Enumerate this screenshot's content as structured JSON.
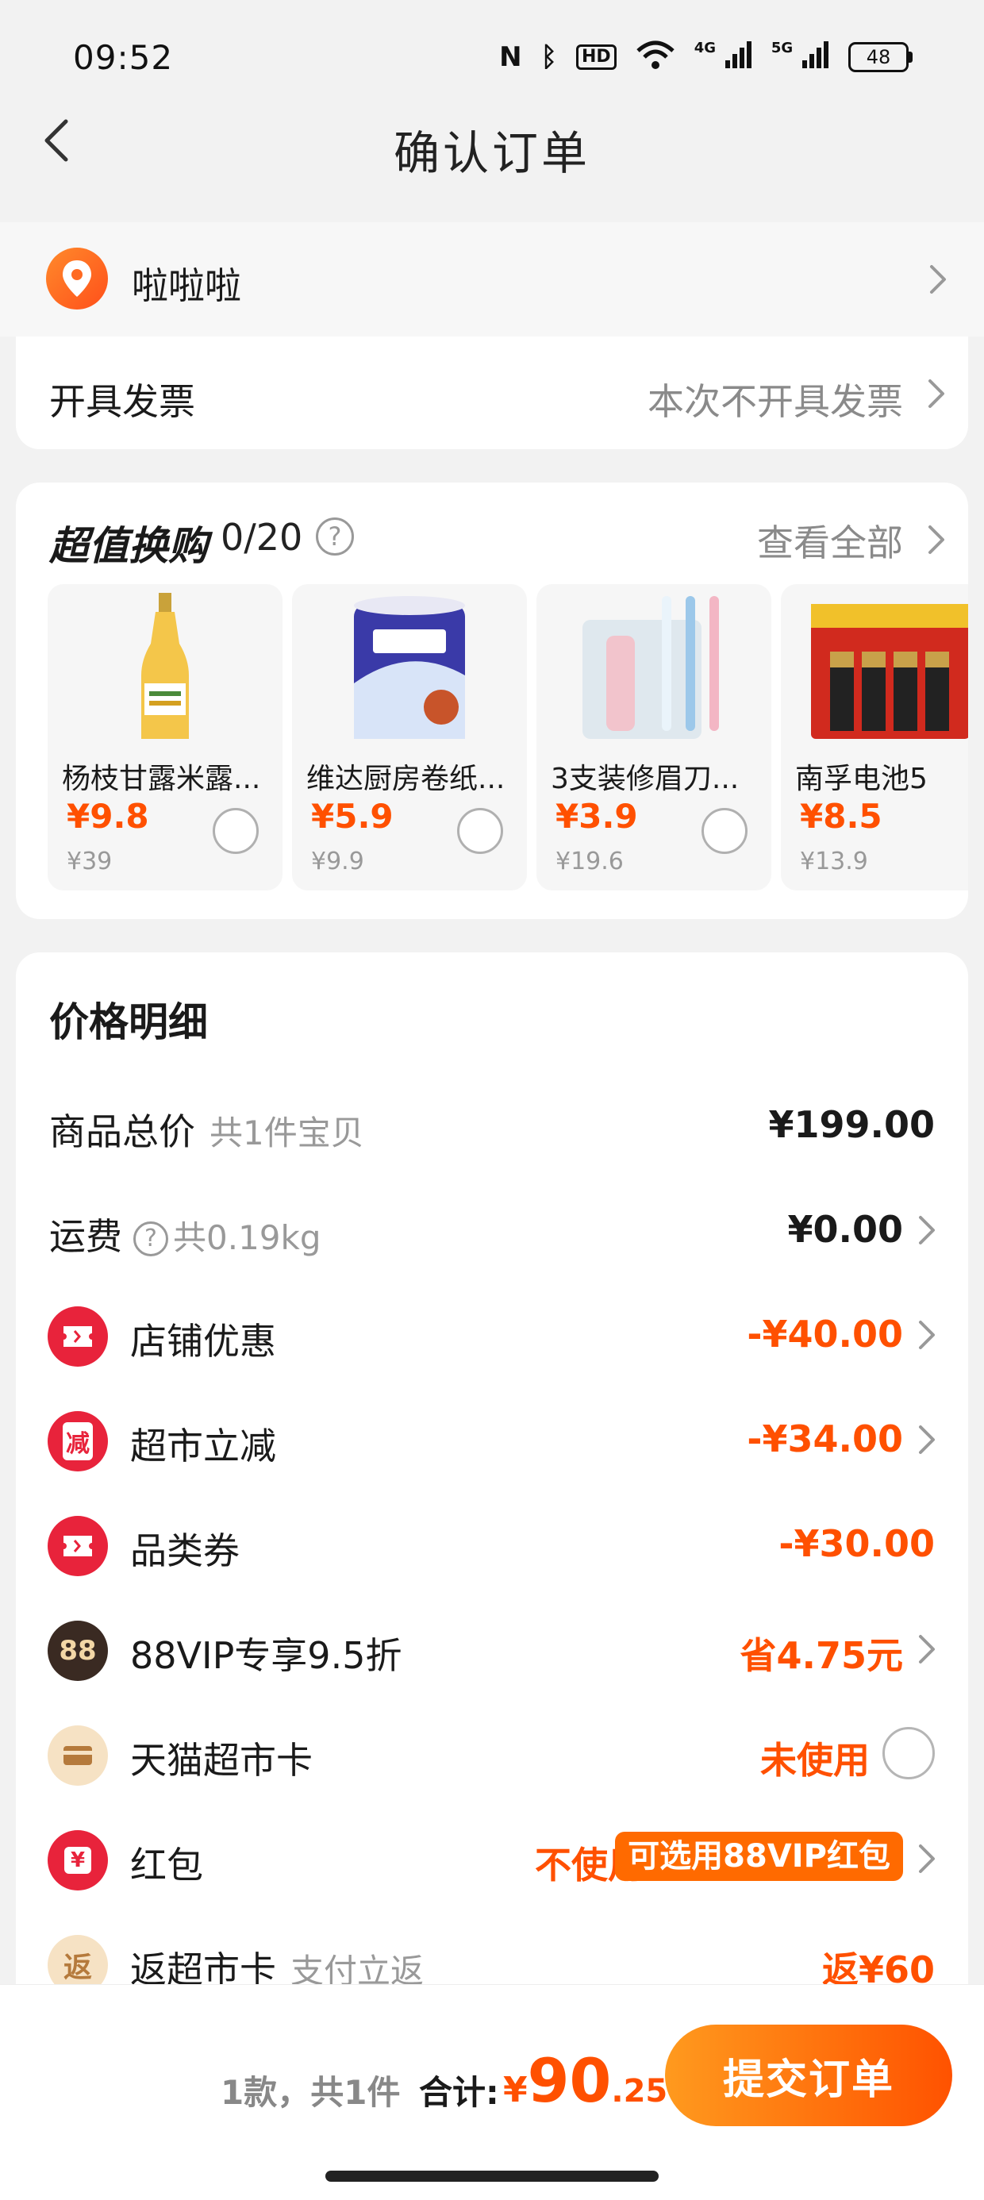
{
  "status": {
    "time": "09:52",
    "icons": [
      "nfc-icon",
      "bluetooth-icon",
      "hd-icon",
      "wifi-icon",
      "4g-signal-icon",
      "5g-signal-icon"
    ],
    "hd": "HD",
    "net1": "4G",
    "net2": "5G",
    "battery": "48"
  },
  "nav": {
    "title": "确认订单"
  },
  "address": {
    "name": "啦啦啦"
  },
  "invoice": {
    "label": "开具发票",
    "value": "本次不开具发票"
  },
  "exchange": {
    "title": "超值换购",
    "count": "0/20",
    "help": "?",
    "view_all": "查看全部",
    "items": [
      {
        "name": "杨枝甘露米露...",
        "price": "¥9.8",
        "orig": "¥39",
        "image": "juice-bottle"
      },
      {
        "name": "维达厨房卷纸...",
        "price": "¥5.9",
        "orig": "¥9.9",
        "image": "paper-towel"
      },
      {
        "name": "3支装修眉刀...",
        "price": "¥3.9",
        "orig": "¥19.6",
        "image": "eyebrow-razor"
      },
      {
        "name": "南孚电池5",
        "price": "¥8.5",
        "orig": "¥13.9",
        "image": "batteries"
      }
    ]
  },
  "detail": {
    "title": "价格明细",
    "goods_total": {
      "label": "商品总价",
      "sub": "共1件宝贝",
      "value": "¥199.00"
    },
    "shipping": {
      "label": "运费",
      "help": "?",
      "sub": "共0.19kg",
      "value": "¥0.00"
    },
    "shop_discount": {
      "label": "店铺优惠",
      "value": "-¥40.00"
    },
    "market_cut": {
      "label": "超市立减",
      "icon_text": "减",
      "value": "-¥34.00"
    },
    "category_coupon": {
      "label": "品类券",
      "value": "-¥30.00"
    },
    "vip": {
      "label": "88VIP专享9.5折",
      "icon_text": "88",
      "value": "省4.75元"
    },
    "market_card": {
      "label": "天猫超市卡",
      "value": "未使用"
    },
    "redpacket": {
      "label": "红包",
      "icon_text": "¥",
      "value": "不使用",
      "tag": "可选用88VIP红包"
    },
    "return_card": {
      "label": "返超市卡",
      "icon_text": "返",
      "sub": "支付立返",
      "value": "返¥60"
    }
  },
  "bottom": {
    "count": "1款，共1件",
    "total_label": "合计:",
    "yen": "¥",
    "total_int": "90",
    "total_dec": ".25",
    "submit": "提交订单"
  },
  "colors": {
    "accent": "#ff5000",
    "button_start": "#ff9a1e",
    "button_end": "#ff5200",
    "coupon_red": "#e8233b"
  }
}
